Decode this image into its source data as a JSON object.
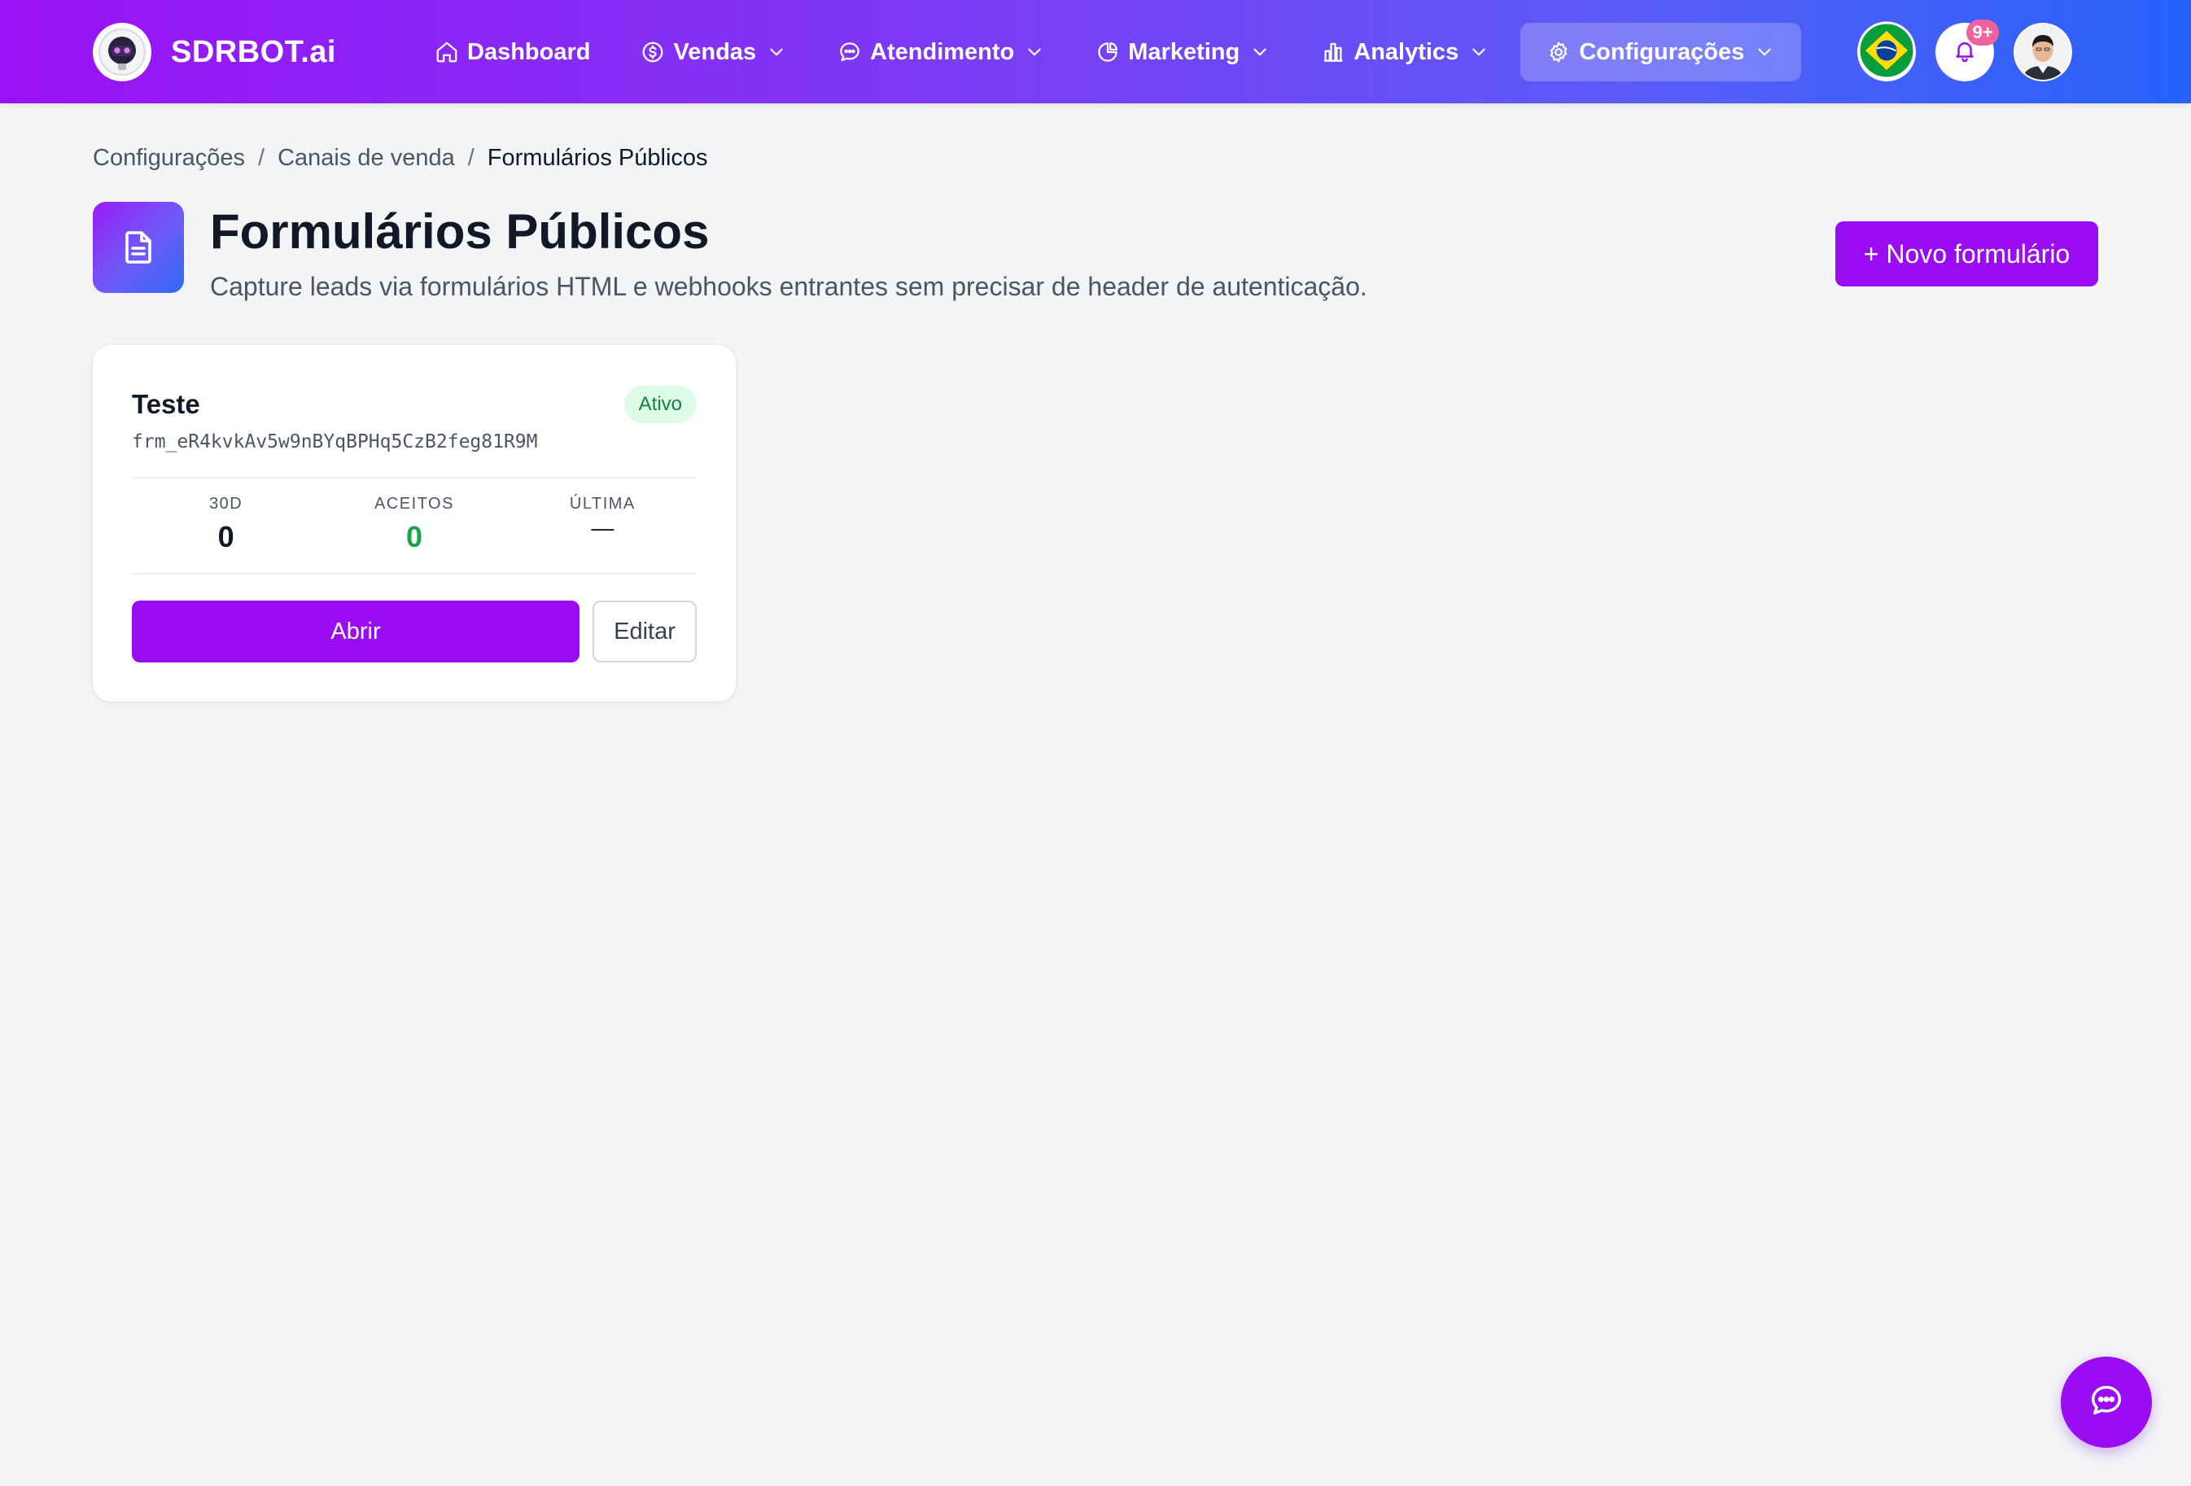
{
  "brand": {
    "name": "SDRBOT.ai",
    "logo_icon": "robot-logo-icon"
  },
  "nav": {
    "items": [
      {
        "label": "Dashboard",
        "icon": "home-icon",
        "has_dropdown": false
      },
      {
        "label": "Vendas",
        "icon": "dollar-circle-icon",
        "has_dropdown": true
      },
      {
        "label": "Atendimento",
        "icon": "chat-bubble-icon",
        "has_dropdown": true
      },
      {
        "label": "Marketing",
        "icon": "pie-chart-icon",
        "has_dropdown": true
      },
      {
        "label": "Analytics",
        "icon": "bar-chart-icon",
        "has_dropdown": true
      },
      {
        "label": "Configurações",
        "icon": "gear-icon",
        "has_dropdown": true,
        "active": true
      }
    ]
  },
  "header_right": {
    "language_icon": "brazil-flag-icon",
    "notifications": {
      "icon": "bell-icon",
      "badge": "9+"
    },
    "avatar_icon": "user-avatar"
  },
  "breadcrumb": [
    "Configurações",
    "Canais de venda",
    "Formulários Públicos"
  ],
  "page": {
    "icon": "document-icon",
    "title": "Formulários Públicos",
    "subtitle": "Capture leads via formulários HTML e webhooks entrantes sem precisar de header de autenticação.",
    "new_button": "+ Novo formulário"
  },
  "forms": [
    {
      "name": "Teste",
      "status": "Ativo",
      "id": "frm_eR4kvkAv5w9nBYqBPHq5CzB2feg81R9M",
      "stats": [
        {
          "label": "30D",
          "value": "0"
        },
        {
          "label": "ACEITOS",
          "value": "0"
        },
        {
          "label": "ÚLTIMA",
          "value": "—"
        }
      ],
      "open_label": "Abrir",
      "edit_label": "Editar"
    }
  ],
  "chat_fab": {
    "icon": "chat-icon"
  },
  "colors": {
    "primary": "#9a0cf2",
    "header_gradient_start": "#9a12f5",
    "header_gradient_end": "#2563fb",
    "status_green": "#16a34a",
    "status_badge_bg": "#dcfce7",
    "notif_badge": "#f0629b"
  }
}
